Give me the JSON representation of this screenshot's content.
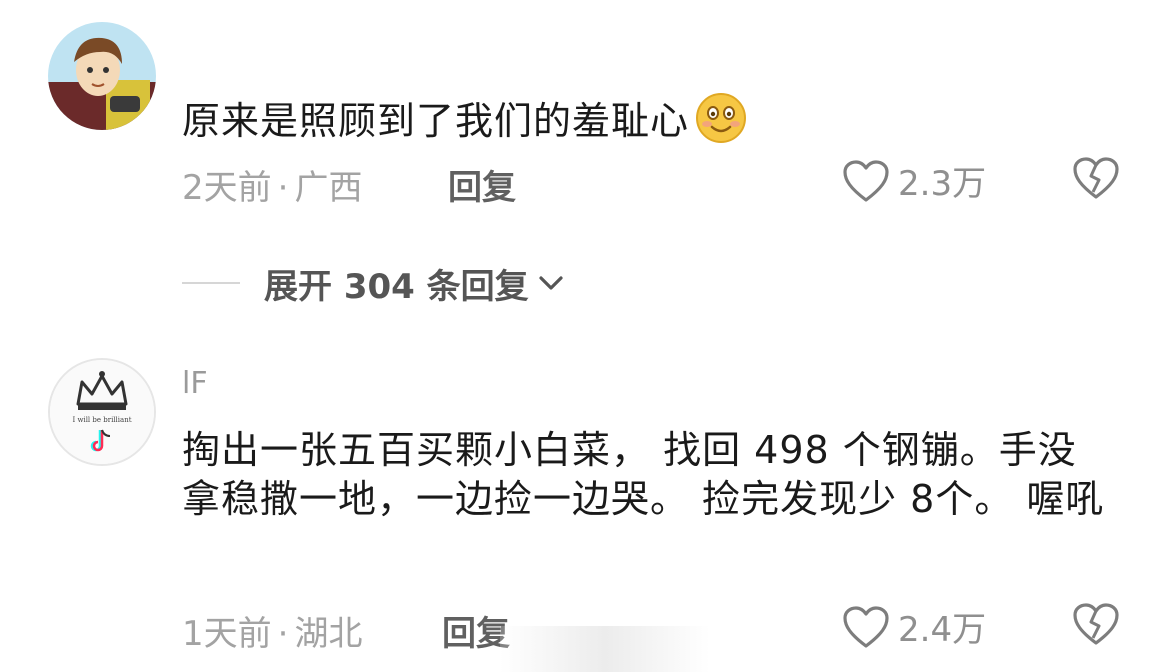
{
  "comments": [
    {
      "username": "",
      "text": "原来是照顾到了我们的羞耻心",
      "emoji": "smiling-face-emoji",
      "time": "2天前",
      "location": "广西",
      "reply_label": "回复",
      "likes": "2.3万",
      "replies_expand": "展开 304 条回复"
    },
    {
      "username": "lF",
      "text": "掏出一张五百买颗小白菜， 找回 498 个钢镚。手没拿稳撒一地，一边捡一边哭。 捡完发现少 8个。 喔吼",
      "avatar_caption": "I will be brilliant",
      "time": "1天前",
      "location": "湖北",
      "reply_label": "回复",
      "likes": "2.4万"
    }
  ],
  "icons": {
    "like": "heart-outline-icon",
    "dislike": "broken-heart-icon",
    "expand": "chevron-down-icon"
  },
  "colors": {
    "text": "#1a1a1a",
    "meta": "#a3a3a3",
    "reply": "#606060",
    "emoji": "#f6c744"
  }
}
